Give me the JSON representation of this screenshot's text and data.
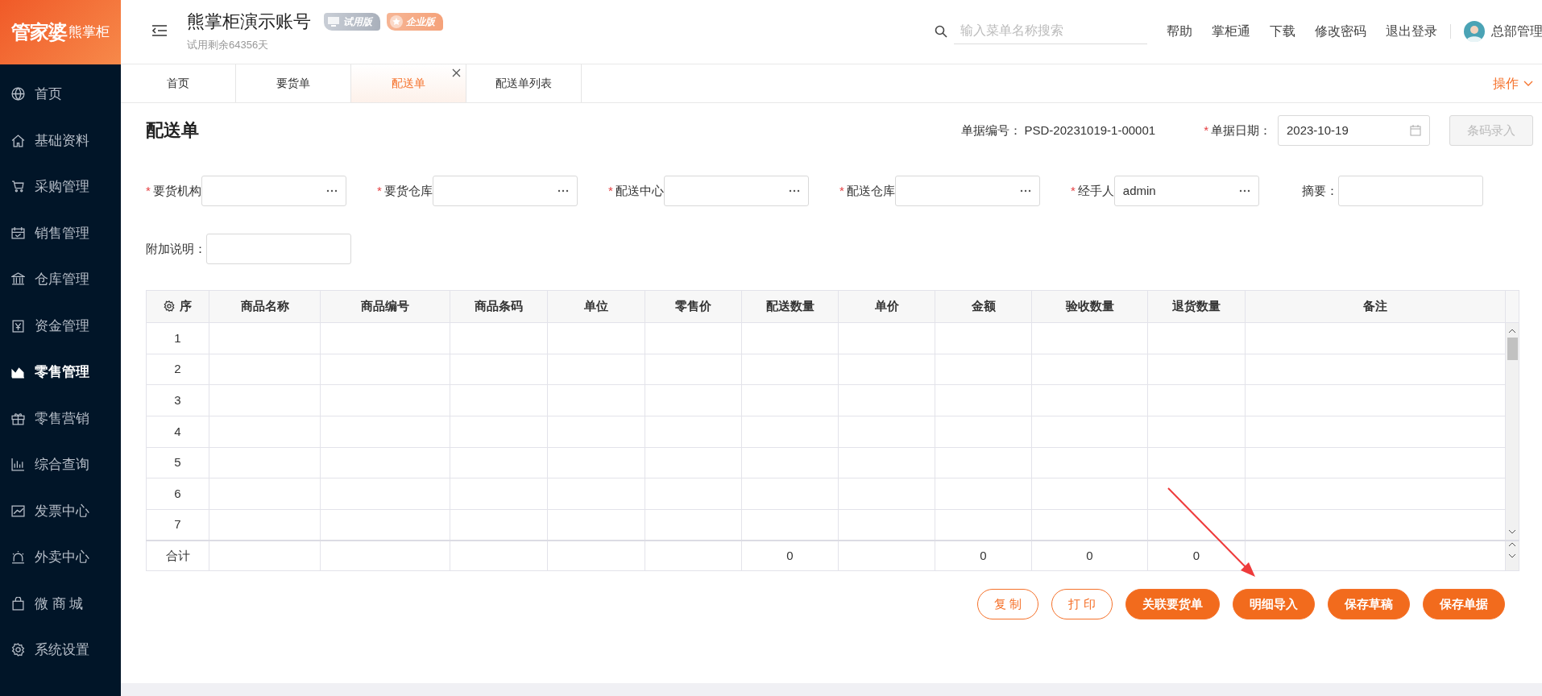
{
  "logo": {
    "brand": "管家婆",
    "product": "熊掌柜"
  },
  "header": {
    "account_name": "熊掌柜演示账号",
    "badges": [
      {
        "label": "试用版",
        "kind": "trial"
      },
      {
        "label": "企业版",
        "kind": "enterprise"
      }
    ],
    "trial_remaining": "试用剩余64356天",
    "search": {
      "placeholder": "输入菜单名称搜索"
    },
    "links": [
      "帮助",
      "掌柜通",
      "下载",
      "修改密码",
      "退出登录"
    ],
    "user": "总部管理"
  },
  "sidebar": {
    "items": [
      {
        "label": "首页",
        "selected": false
      },
      {
        "label": "基础资料",
        "selected": false
      },
      {
        "label": "采购管理",
        "selected": false
      },
      {
        "label": "销售管理",
        "selected": false
      },
      {
        "label": "仓库管理",
        "selected": false
      },
      {
        "label": "资金管理",
        "selected": false
      },
      {
        "label": "零售管理",
        "selected": true
      },
      {
        "label": "零售营销",
        "selected": false
      },
      {
        "label": "综合查询",
        "selected": false
      },
      {
        "label": "发票中心",
        "selected": false
      },
      {
        "label": "外卖中心",
        "selected": false
      },
      {
        "label": "微 商 城",
        "selected": false
      },
      {
        "label": "系统设置",
        "selected": false
      }
    ]
  },
  "tabs": [
    {
      "label": "首页",
      "selected": false,
      "closable": false
    },
    {
      "label": "要货单",
      "selected": false,
      "closable": false
    },
    {
      "label": "配送单",
      "selected": true,
      "closable": true
    },
    {
      "label": "配送单列表",
      "selected": false,
      "closable": false
    }
  ],
  "action_menu": "操作",
  "form": {
    "title": "配送单",
    "doc_number": {
      "label": "单据编号：",
      "value": "PSD-20231019-1-00001"
    },
    "doc_date": {
      "marker": "*",
      "label": "单据日期：",
      "value": "2023-10-19"
    },
    "barcode_button": {
      "label": "条码录入",
      "disabled": true
    },
    "fields": [
      {
        "marker": "*",
        "label": "要货机构",
        "kind": "picker"
      },
      {
        "marker": "*",
        "label": "要货仓库",
        "kind": "picker"
      },
      {
        "marker": "*",
        "label": "配送中心",
        "kind": "picker"
      },
      {
        "marker": "*",
        "label": "配送仓库",
        "kind": "picker"
      },
      {
        "marker": "*",
        "label": "经手人",
        "kind": "picker",
        "value": "admin"
      },
      {
        "label": "摘要：",
        "kind": "text"
      },
      {
        "label": "附加说明：",
        "kind": "text"
      }
    ]
  },
  "table": {
    "columns": [
      "序",
      "商品名称",
      "商品编号",
      "商品条码",
      "单位",
      "零售价",
      "配送数量",
      "单价",
      "金额",
      "验收数量",
      "退货数量",
      "备注"
    ],
    "rows": [
      "1",
      "2",
      "3",
      "4",
      "5",
      "6",
      "7"
    ],
    "total": {
      "label": "合计",
      "cells": [
        null,
        null,
        null,
        null,
        null,
        "0",
        null,
        "0",
        "0",
        "0",
        null
      ]
    }
  },
  "buttons": [
    {
      "label": "复 制",
      "kind": "outline"
    },
    {
      "label": "打 印",
      "kind": "outline"
    },
    {
      "label": "关联要货单",
      "kind": "solid"
    },
    {
      "label": "明细导入",
      "kind": "solid"
    },
    {
      "label": "保存草稿",
      "kind": "solid"
    },
    {
      "label": "保存单据",
      "kind": "solid"
    }
  ]
}
